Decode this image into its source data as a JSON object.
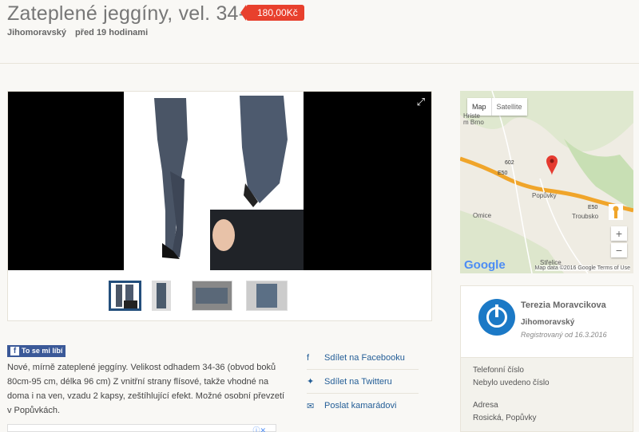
{
  "listing": {
    "title": "Zateplené jeggíny, vel. 34-36",
    "price": "180,00Kč",
    "region": "Jihomoravský",
    "posted": "před 19 hodinami"
  },
  "gallery": {
    "expand_icon": "fullscreen-icon"
  },
  "social": {
    "like_label": "To se mi líbí"
  },
  "description": {
    "text": "Nové, mírně zateplené jeggíny. Velikost odhadem 34-36 (obvod boků 80cm-95 cm, délka 96 cm) Z vnitřní strany flísové, takže vhodné na doma i na ven, vzadu 2 kapsy, zeštíhlující efekt. Možné osobní převzetí v Popůvkách."
  },
  "share": {
    "facebook": "Sdílet na Facebooku",
    "twitter": "Sdílet na Twitteru",
    "email": "Poslat kamarádovi"
  },
  "map": {
    "tab_map": "Map",
    "tab_satellite": "Satellite",
    "labels": {
      "town": "Popůvky",
      "troubsko": "Troubsko",
      "omice": "Omice",
      "strelice": "Střelice",
      "hriste": "Hriste",
      "brno": "m Brno",
      "e50a": "E50",
      "e50b": "E50",
      "r602": "602"
    },
    "zoom_in": "+",
    "zoom_out": "−",
    "attribution": "Map data ©2016 Google",
    "terms": "Terms of Use",
    "logo": "Google"
  },
  "seller": {
    "name": "Terezia Moravcikova",
    "region": "Jihomoravský",
    "registered": "Registrovaný od 16.3.2016",
    "phone_label": "Telefonní číslo",
    "phone_value": "Nebylo uvedeno číslo",
    "address_label": "Adresa",
    "address_value": "Rosická, Popůvky"
  }
}
